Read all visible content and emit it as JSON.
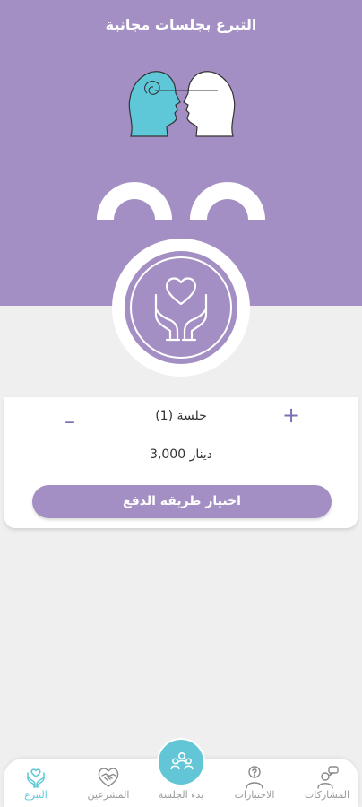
{
  "header": {
    "title": "التبرع بجلسات مجانية"
  },
  "colors": {
    "primary": "#a48fc4",
    "accent": "#5ec8d8",
    "background": "#efefef"
  },
  "illustration": {
    "icon": "two-heads-connection-icon"
  },
  "emblem": {
    "icon": "heart-hands-icon"
  },
  "donation": {
    "increment_label": "+",
    "decrement_label": "–",
    "session_count_label": "(1) جلسة",
    "price": "3,000 دينار",
    "pay_button_label": "اختيار طريقة الدفع"
  },
  "bottom_nav": {
    "items": [
      {
        "label": "المشاركات",
        "icon": "chat-person-icon",
        "active": false
      },
      {
        "label": "الاختبارات",
        "icon": "quiz-person-icon",
        "active": false
      },
      {
        "label": "بدء الجلسة",
        "icon": "group-session-icon",
        "active": false
      },
      {
        "label": "المشرعين",
        "icon": "handshake-heart-icon",
        "active": false
      },
      {
        "label": "التبرع",
        "icon": "heart-hands-icon",
        "active": true
      }
    ]
  }
}
